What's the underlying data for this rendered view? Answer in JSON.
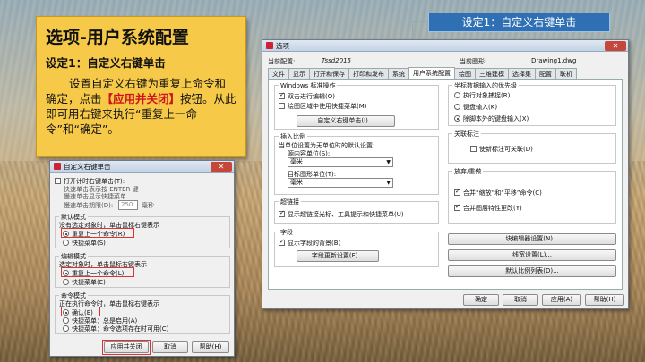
{
  "note": {
    "title": "选项-用户系统配置",
    "subtitle": "设定1：自定义右键单击",
    "body_pre": "设置自定义右键为重复上命令和确定，点击",
    "body_highlight": "【应用并关闭】",
    "body_post": "按钮。从此即可用右键来执行“重复上一命令”和“确定”。"
  },
  "callout": {
    "label": "设定1：自定义右键单击"
  },
  "options_dialog": {
    "title": "选项",
    "current_config_label": "当前配置:",
    "current_config_value": "Tssd2015",
    "current_drawing_label": "当前图形:",
    "current_drawing_value": "Drawing1.dwg",
    "tabs": [
      "文件",
      "显示",
      "打开和保存",
      "打印和发布",
      "系统",
      "用户系统配置",
      "绘图",
      "三维建模",
      "选择集",
      "配置",
      "联机"
    ],
    "windows_group": "Windows 标准操作",
    "dblclick": "双击进行编辑(O)",
    "shortcut_menu": "绘图区域中使用快捷菜单(M)",
    "right_click_btn": "自定义右键单击(I)...",
    "insert_group": "插入比例",
    "insert_desc": "当单位设置为无单位时的默认设置:",
    "source_label": "源内容单位(S):",
    "source_value": "毫米",
    "target_label": "目标图形单位(T):",
    "target_value": "毫米",
    "hyperlink_group": "超链接",
    "hyperlink_chk": "显示超链接光标、工具提示和快捷菜单(U)",
    "fields_group": "字段",
    "fields_chk": "显示字段的背景(B)",
    "fields_btn": "字段更新设置(F)...",
    "coord_group": "坐标数据输入的优先级",
    "coord_opt1": "执行对象捕捉(R)",
    "coord_opt2": "键盘输入(K)",
    "coord_opt3": "除脚本外的键盘输入(X)",
    "assoc_group": "关联标注",
    "assoc_chk": "使新标注可关联(D)",
    "undo_group": "放弃/重做",
    "undo_chk1": "合并“缩放”和“平移”命令(C)",
    "undo_chk2": "合并图层特性更改(Y)",
    "block_editor_btn": "块编辑器设置(N)...",
    "lineweight_btn": "线宽设置(L)...",
    "scale_list_btn": "默认比例列表(D)...",
    "ok": "确定",
    "cancel": "取消",
    "apply": "应用(A)",
    "help": "帮助(H)"
  },
  "rc_dialog": {
    "title": "自定义右键单击",
    "timed_chk": "打开计时右键单击(T):",
    "timed_desc1": "快速单击表示按 ENTER 键",
    "timed_desc2": "慢速单击显示快捷菜单",
    "duration_label": "慢速单击期限(D):",
    "duration_value": "250",
    "duration_unit": "毫秒",
    "default_group": "默认模式",
    "default_desc": "没有选定对象时，单击鼠标右键表示",
    "default_opt1": "重复上一个命令(R)",
    "default_opt2": "快捷菜单(S)",
    "edit_group": "编辑模式",
    "edit_desc": "选定对象时，单击鼠标右键表示",
    "edit_opt1": "重复上一个命令(L)",
    "edit_opt2": "快捷菜单(E)",
    "cmd_group": "命令模式",
    "cmd_desc": "正在执行命令时，单击鼠标右键表示",
    "cmd_opt1": "确认(E)",
    "cmd_opt2": "快捷菜单：总是启用(A)",
    "cmd_opt3": "快捷菜单：命令选项存在时可用(C)",
    "apply_close": "应用并关闭",
    "cancel": "取消",
    "help": "帮助(H)"
  }
}
